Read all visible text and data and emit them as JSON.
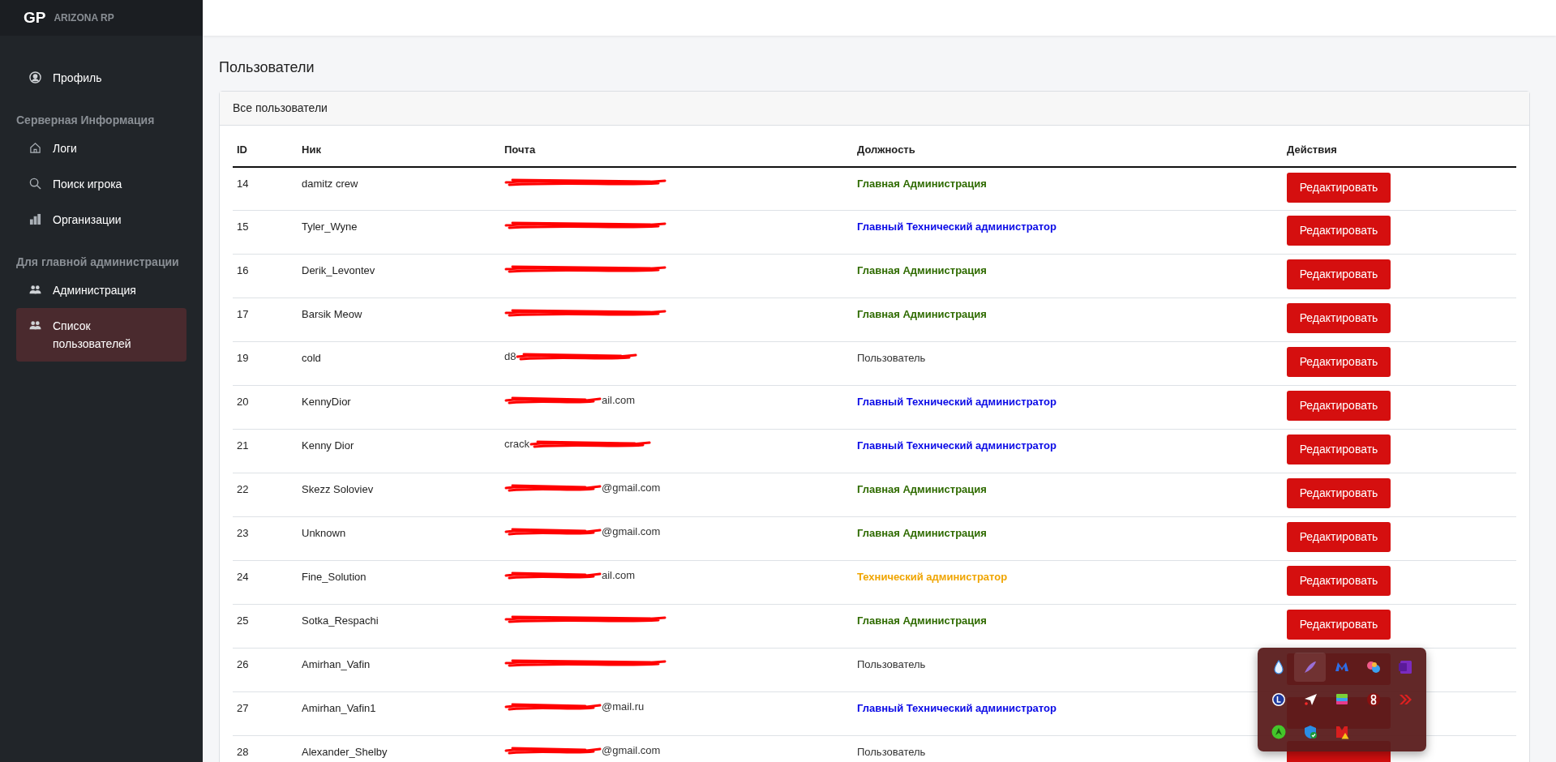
{
  "brand": {
    "logo": "GP",
    "name": "ARIZONA RP"
  },
  "sidebar": [
    {
      "kind": "item",
      "label": "Профиль",
      "selected": false
    },
    {
      "kind": "heading",
      "label": "Серверная Информация"
    },
    {
      "kind": "item",
      "label": "Логи",
      "selected": false
    },
    {
      "kind": "item",
      "label": "Поиск игрока",
      "selected": false
    },
    {
      "kind": "item",
      "label": "Организации",
      "selected": false
    },
    {
      "kind": "heading",
      "label": "Для главной администрации"
    },
    {
      "kind": "item",
      "label": "Администрация",
      "selected": false
    },
    {
      "kind": "item",
      "label": "Список пользователей",
      "selected": true
    }
  ],
  "page_title": "Пользователи",
  "card_title": "Все пользователи",
  "table": {
    "columns": [
      "ID",
      "Ник",
      "Почта",
      "Должность",
      "Действия"
    ],
    "rows": [
      {
        "id": "14",
        "nick": "damitz crew",
        "email": {
          "kind": "hidden"
        },
        "role": {
          "text": "Главная Администрация",
          "kind": "head_admin"
        },
        "action": "Редактировать"
      },
      {
        "id": "15",
        "nick": "Tyler_Wyne",
        "email": {
          "kind": "hidden"
        },
        "role": {
          "text": "Главный Технический администратор",
          "kind": "chief_tech"
        },
        "action": "Редактировать"
      },
      {
        "id": "16",
        "nick": "Derik_Levontev",
        "email": {
          "kind": "hidden"
        },
        "role": {
          "text": "Главная Администрация",
          "kind": "head_admin"
        },
        "action": "Редактировать"
      },
      {
        "id": "17",
        "nick": "Barsik Meow",
        "email": {
          "kind": "hidden"
        },
        "role": {
          "text": "Главная Администрация",
          "kind": "head_admin"
        },
        "action": "Редактировать"
      },
      {
        "id": "19",
        "nick": "cold",
        "email": {
          "kind": "head",
          "shown": "d8"
        },
        "role": {
          "text": "Пользователь",
          "kind": "user"
        },
        "action": "Редактировать"
      },
      {
        "id": "20",
        "nick": "KennyDior",
        "email": {
          "kind": "tail",
          "shown": "ail.com"
        },
        "role": {
          "text": "Главный Технический администратор",
          "kind": "chief_tech"
        },
        "action": "Редактировать"
      },
      {
        "id": "21",
        "nick": "Kenny Dior",
        "email": {
          "kind": "head",
          "shown": "crack"
        },
        "role": {
          "text": "Главный Технический администратор",
          "kind": "chief_tech"
        },
        "action": "Редактировать"
      },
      {
        "id": "22",
        "nick": "Skezz Soloviev",
        "email": {
          "kind": "tail",
          "shown": "@gmail.com"
        },
        "role": {
          "text": "Главная Администрация",
          "kind": "head_admin"
        },
        "action": "Редактировать"
      },
      {
        "id": "23",
        "nick": "Unknown",
        "email": {
          "kind": "tail",
          "shown": "@gmail.com"
        },
        "role": {
          "text": "Главная Администрация",
          "kind": "head_admin"
        },
        "action": "Редактировать"
      },
      {
        "id": "24",
        "nick": "Fine_Solution",
        "email": {
          "kind": "tail",
          "shown": "ail.com"
        },
        "role": {
          "text": "Технический администратор",
          "kind": "tech"
        },
        "action": "Редактировать"
      },
      {
        "id": "25",
        "nick": "Sotka_Respachi",
        "email": {
          "kind": "hidden"
        },
        "role": {
          "text": "Главная Администрация",
          "kind": "head_admin"
        },
        "action": "Редактировать"
      },
      {
        "id": "26",
        "nick": "Amirhan_Vafin",
        "email": {
          "kind": "hidden"
        },
        "role": {
          "text": "Пользователь",
          "kind": "user"
        }
      },
      {
        "id": "27",
        "nick": "Amirhan_Vafin1",
        "email": {
          "kind": "tail",
          "shown": "@mail.ru"
        },
        "role": {
          "text": "Главный Технический администратор",
          "kind": "chief_tech"
        }
      },
      {
        "id": "28",
        "nick": "Alexander_Shelby",
        "email": {
          "kind": "tail",
          "shown": "@gmail.com"
        },
        "role": {
          "text": "Пользователь",
          "kind": "user"
        }
      }
    ]
  }
}
